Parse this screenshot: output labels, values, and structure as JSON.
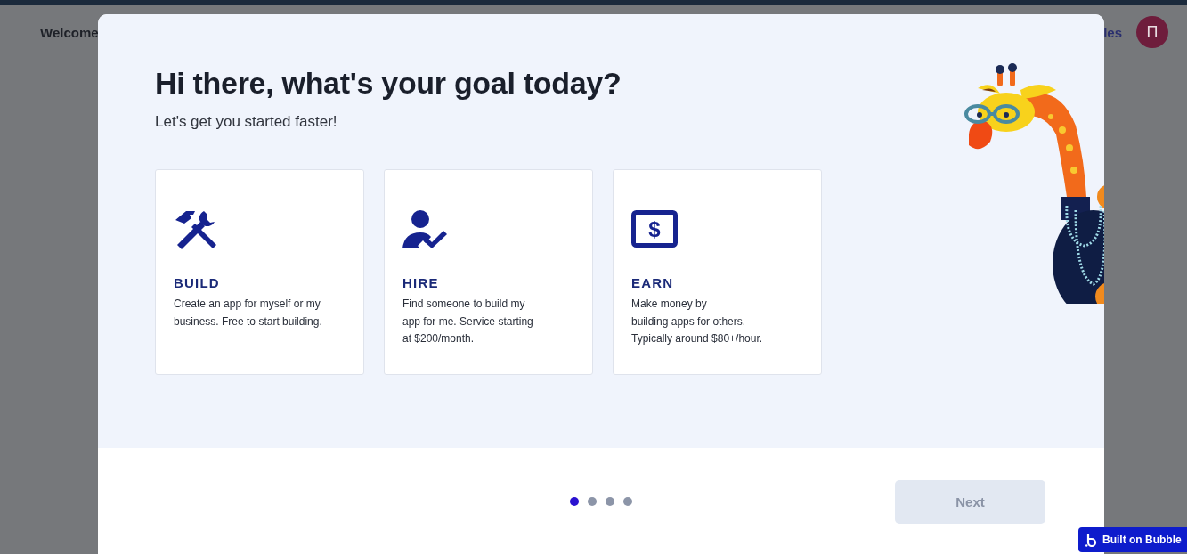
{
  "background": {
    "greeting": "Welcome",
    "nav_link": "les",
    "avatar_initial": "П"
  },
  "modal": {
    "title": "Hi there, what's your goal today?",
    "subtitle": "Let's get you started faster!",
    "cards": [
      {
        "kind": "build",
        "title": "BUILD",
        "description": "Create an app for myself or my\nbusiness. Free to start building."
      },
      {
        "kind": "hire",
        "title": "HIRE",
        "description": "Find someone to build my\napp for me. Service starting\nat $200/month."
      },
      {
        "kind": "earn",
        "icon_text": "$",
        "title": "EARN",
        "description": "Make money by\nbuilding apps for others.\nTypically around $80+/hour."
      }
    ],
    "pager": [
      {
        "selected": true
      },
      {
        "selected": false
      },
      {
        "selected": false
      },
      {
        "selected": false
      }
    ],
    "next_button": {
      "label": "Next",
      "disabled": true
    }
  },
  "badge": {
    "label": "Built on Bubble"
  }
}
